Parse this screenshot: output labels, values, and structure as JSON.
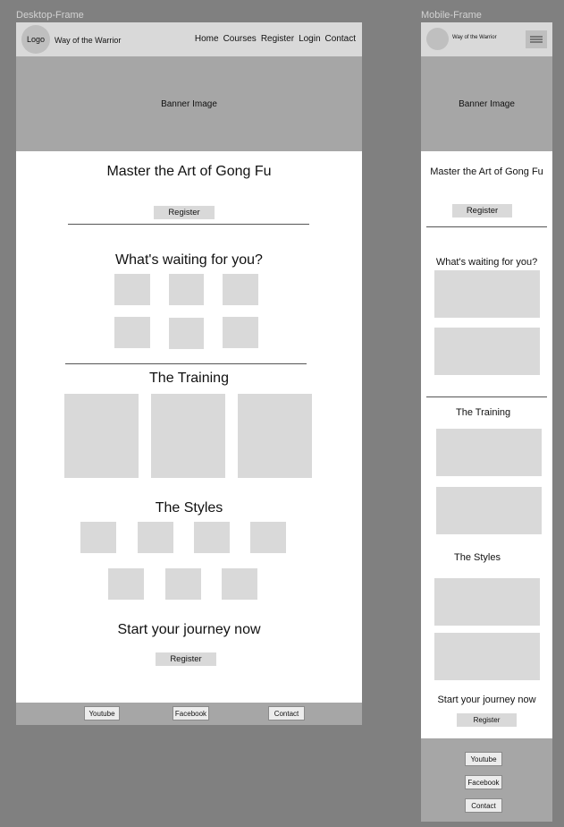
{
  "labels": {
    "desktop": "Desktop-Frame",
    "mobile": "Mobile-Frame"
  },
  "desktop": {
    "logo": "Logo",
    "site_title": "Way of the Warrior",
    "nav": [
      "Home",
      "Courses",
      "Register",
      "Login",
      "Contact"
    ],
    "banner": "Banner Image",
    "hero_title": "Master the Art of Gong Fu",
    "register_label": "Register",
    "waiting_title": "What's waiting for you?",
    "training_title": "The Training",
    "styles_title": "The Styles",
    "journey_title": "Start your journey now",
    "journey_register_label": "Register",
    "footer_links": [
      "Youtube",
      "Facebook",
      "Contact"
    ]
  },
  "mobile": {
    "site_title": "Way of the Warrior",
    "banner": "Banner Image",
    "hero_title": "Master the Art of Gong Fu",
    "register_label": "Register",
    "waiting_title": "What's waiting for you?",
    "training_title": "The Training",
    "styles_title": "The Styles",
    "journey_title": "Start your journey now",
    "journey_register_label": "Register",
    "footer_links": [
      "Youtube",
      "Facebook",
      "Contact"
    ]
  }
}
